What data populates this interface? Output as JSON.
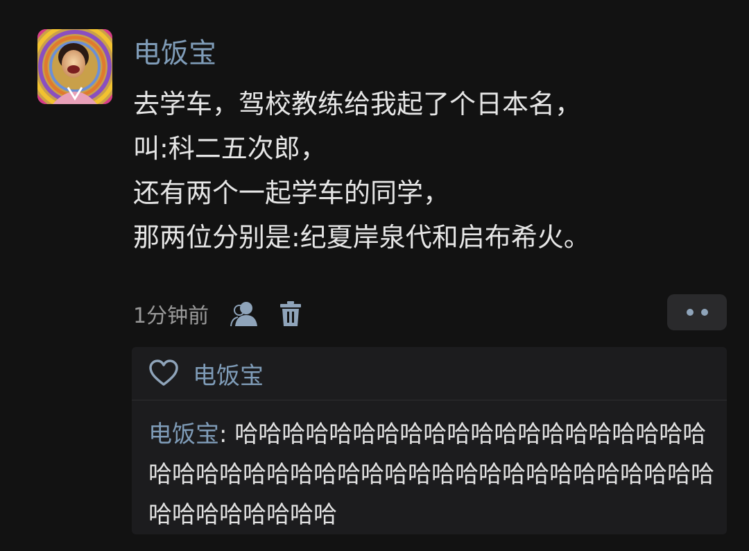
{
  "post": {
    "author": "电饭宝",
    "lines": [
      "去学车，驾校教练给我起了个日本名，",
      "叫:科二五次郎，",
      "还有两个一起学车的同学，",
      "那两位分别是:纪夏岸泉代和启布希火。"
    ],
    "time": "1分钟前"
  },
  "likes": {
    "name": "电饭宝"
  },
  "reply": {
    "author": "电饭宝",
    "separator": ": ",
    "text": "哈哈哈哈哈哈哈哈哈哈哈哈哈哈哈哈哈哈哈哈哈哈哈哈哈哈哈哈哈哈哈哈哈哈哈哈哈哈哈哈哈哈哈哈哈哈哈哈哈哈哈哈"
  },
  "colors": {
    "background": "#121212",
    "name_blue": "#7f9cb8",
    "panel": "#1c1c1e"
  },
  "icons": [
    "avatar",
    "user-icon",
    "trash-icon",
    "more-icon",
    "heart-icon"
  ]
}
